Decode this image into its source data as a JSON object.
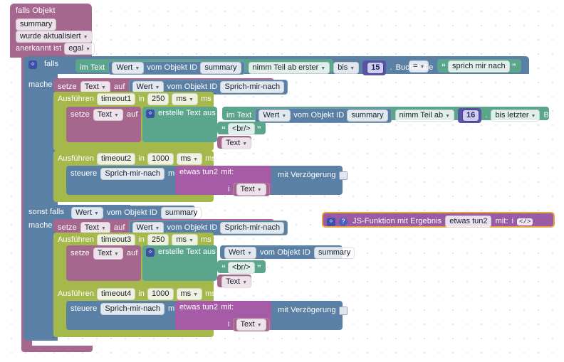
{
  "app": {
    "kind": "blockly-workspace",
    "language": "de",
    "colors": {
      "event": "#a5678e",
      "control": "#5b80a5",
      "variable": "#a5678e",
      "timer": "#a5b84c",
      "text": "#5ba58c",
      "value": "#5b80a5",
      "custom": "#a55ba5",
      "js": "#9a5ba5",
      "number_socket": "#5b54a5",
      "js_outline": "#e8a33d",
      "canvas": "#ffffff"
    }
  },
  "hat_block": {
    "line1": "falls Objekt",
    "object_id": "summary",
    "trigger": "wurde aktualisiert",
    "ack_label": "anerkannt ist",
    "ack_value": "egal"
  },
  "if_block": {
    "gear_icon": "gear-icon",
    "label": "falls",
    "do_label": "mache",
    "else_if_label": "sonst falls"
  },
  "condition": {
    "text_label": "im Text",
    "value_getter": {
      "field": "Wert",
      "label": "vom Objekt ID",
      "object_id": "summary"
    },
    "substring": {
      "from_label": "nimm Teil ab erster",
      "to_label": "bis",
      "index": "15",
      "dot": ".",
      "unit_label": "Buchstabe"
    },
    "compare_op": "=",
    "compare_text": "sprich mir nach"
  },
  "branch_then": {
    "set_block": {
      "set_label": "setze",
      "variable": "Text",
      "to_label": "auf",
      "value": {
        "field": "Wert",
        "label": "vom Objekt ID",
        "object_id": "Sprich-mir-nach"
      }
    },
    "timeout_a": {
      "run_label": "Ausführen",
      "name": "timeout1",
      "in_label": "in",
      "delay": "250",
      "unit": "ms",
      "unit_suffix": "ms",
      "body": {
        "set_label": "setze",
        "variable": "Text",
        "to_label": "auf",
        "join": {
          "gear_icon": "gear-icon",
          "label": "erstelle Text aus",
          "items": [
            {
              "kind": "substring",
              "text_label": "im Text",
              "field": "Wert",
              "object_label": "vom Objekt ID",
              "object_id": "summary",
              "from_label": "nimm Teil ab",
              "index": "16",
              "dot": ".",
              "to_label": "bis letzter",
              "unit_label": "Buchstabe"
            },
            {
              "kind": "string",
              "value": "<br/>"
            },
            {
              "kind": "variable",
              "value": "Text"
            }
          ]
        }
      }
    },
    "timeout_b": {
      "run_label": "Ausführen",
      "name": "timeout2",
      "in_label": "in",
      "delay": "1000",
      "unit": "ms",
      "unit_suffix": "ms",
      "body": {
        "control_label": "steuere",
        "target": "Sprich-mir-nach",
        "with_label": "mit",
        "call": {
          "name": "etwas tun2",
          "with_label": "mit:",
          "arg_name": "i",
          "arg_value": "Text"
        },
        "delay_label": "mit Verzögerung",
        "delay_checked": false
      }
    }
  },
  "else_if": {
    "condition": {
      "field": "Wert",
      "label": "vom Objekt ID",
      "object_id": "summary"
    },
    "do_label": "mache",
    "set_block": {
      "set_label": "setze",
      "variable": "Text",
      "to_label": "auf",
      "value": {
        "field": "Wert",
        "label": "vom Objekt ID",
        "object_id": "Sprich-mir-nach"
      }
    },
    "timeout_a": {
      "run_label": "Ausführen",
      "name": "timeout3",
      "in_label": "in",
      "delay": "250",
      "unit": "ms",
      "unit_suffix": "ms",
      "body": {
        "set_label": "setze",
        "variable": "Text",
        "to_label": "auf",
        "join": {
          "gear_icon": "gear-icon",
          "label": "erstelle Text aus",
          "items": [
            {
              "kind": "value",
              "field": "Wert",
              "object_label": "vom Objekt ID",
              "object_id": "summary"
            },
            {
              "kind": "string",
              "value": "<br/>"
            },
            {
              "kind": "variable",
              "value": "Text"
            }
          ]
        }
      }
    },
    "timeout_b": {
      "run_label": "Ausführen",
      "name": "timeout4",
      "in_label": "in",
      "delay": "1000",
      "unit": "ms",
      "unit_suffix": "ms",
      "body": {
        "control_label": "steuere",
        "target": "Sprich-mir-nach",
        "with_label": "mit",
        "call": {
          "name": "etwas tun2",
          "with_label": "mit:",
          "arg_name": "i",
          "arg_value": "Text"
        },
        "delay_label": "mit Verzögerung",
        "delay_checked": false
      }
    }
  },
  "js_function": {
    "gear_icon": "gear-icon",
    "help_icon": "help-icon",
    "label": "JS-Funktion mit Ergebnis",
    "name": "etwas tun2",
    "with_label": "mit:",
    "arg_name": "i",
    "code_icon": "</>"
  }
}
